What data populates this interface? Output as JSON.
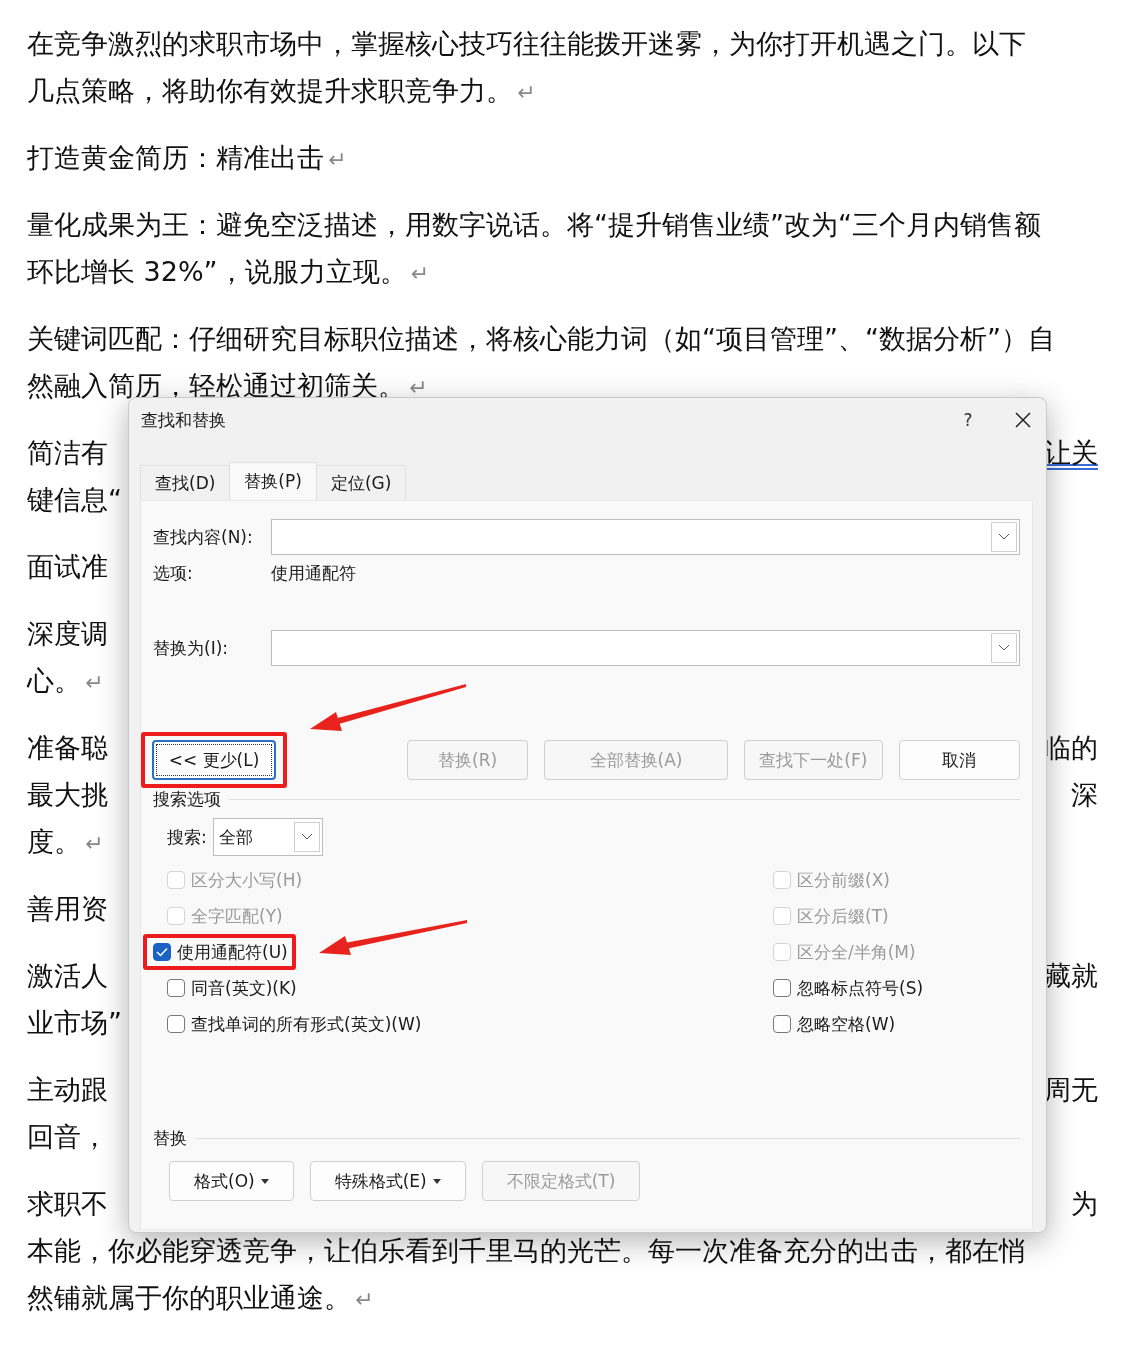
{
  "document": {
    "paragraphs": [
      {
        "lines": [
          {
            "text": "在竞争激烈的求职市场中，掌握核心技巧往往能拨开迷雾，为你打开机遇之门。以下"
          },
          {
            "text": "几点策略，将助你有效提升求职竞争力。"
          }
        ],
        "end_mark": "↵"
      },
      {
        "lines": [
          {
            "text": "打造黄金简历：精准出击"
          }
        ],
        "end_mark": "↵"
      },
      {
        "lines": [
          {
            "text": "量化成果为王：避免空泛描述，用数字说话。将“提升销售业绩”改为“三个月内销售额"
          },
          {
            "text": "环比增长 32%”，说服力立现。"
          }
        ],
        "end_mark": "↵"
      },
      {
        "lines": [
          {
            "text": "关键词匹配：仔细研究目标职位描述，将核心能力词（如“项目管理”、“数据分析”）自"
          },
          {
            "text": "然融入简历，轻松通过初筛关。"
          }
        ],
        "end_mark": "↵"
      },
      {
        "lines": [
          {
            "left": "简洁有",
            "right": "让关"
          },
          {
            "left": "键信息“"
          }
        ]
      },
      {
        "lines": [
          {
            "left": "面试准"
          }
        ]
      },
      {
        "lines": [
          {
            "left": "深度调"
          },
          {
            "text": "心。"
          }
        ],
        "end_mark": "↵"
      },
      {
        "lines": [
          {
            "left": "准备聪",
            "right": "临的"
          },
          {
            "left": "最大挑",
            "right": "深"
          },
          {
            "text": "度。"
          }
        ],
        "end_mark": "↵"
      },
      {
        "lines": [
          {
            "left": "善用资"
          }
        ]
      },
      {
        "lines": [
          {
            "left": "激活人",
            "right": "藏就"
          },
          {
            "left": "业市场”"
          }
        ]
      },
      {
        "lines": [
          {
            "left": "主动跟",
            "right": "周无"
          },
          {
            "left": "回音，"
          }
        ]
      },
      {
        "lines": [
          {
            "left": "求职不",
            "right": "为"
          },
          {
            "text": "本能，你必能穿透竞争，让伯乐看到千里马的光芒。每一次准备充分的出击，都在悄"
          },
          {
            "text": "然铺就属于你的职业通途。"
          }
        ],
        "end_mark": "↵"
      }
    ]
  },
  "dialog": {
    "title": "查找和替换",
    "help": "?",
    "tabs": [
      {
        "label": "查找(D)",
        "selected": false
      },
      {
        "label": "替换(P)",
        "selected": true
      },
      {
        "label": "定位(G)",
        "selected": false
      }
    ],
    "find": {
      "label": "查找内容(N):"
    },
    "options": {
      "label": "选项:",
      "value": "使用通配符"
    },
    "replace": {
      "label": "替换为(I):"
    },
    "buttons": [
      {
        "label": "<< 更少(L)",
        "disabled": false,
        "focused": true,
        "highlighted": true
      },
      {
        "label": "替换(R)",
        "disabled": true,
        "focused": false,
        "highlighted": false
      },
      {
        "label": "全部替换(A)",
        "disabled": true,
        "focused": false,
        "highlighted": false
      },
      {
        "label": "查找下一处(F)",
        "disabled": true,
        "focused": false,
        "highlighted": false
      },
      {
        "label": "取消",
        "disabled": false,
        "focused": false,
        "highlighted": false
      }
    ],
    "search_options": {
      "title": "搜索选项",
      "search_label": "搜索:",
      "search_value": "全部",
      "left": [
        {
          "label": "区分大小写(H)",
          "checked": false,
          "disabled": true,
          "highlighted": false
        },
        {
          "label": "全字匹配(Y)",
          "checked": false,
          "disabled": true,
          "highlighted": false
        },
        {
          "label": "使用通配符(U)",
          "checked": true,
          "disabled": false,
          "highlighted": true
        },
        {
          "label": "同音(英文)(K)",
          "checked": false,
          "disabled": false,
          "highlighted": false
        },
        {
          "label": "查找单词的所有形式(英文)(W)",
          "checked": false,
          "disabled": false,
          "highlighted": false
        }
      ],
      "right": [
        {
          "label": "区分前缀(X)",
          "checked": false,
          "disabled": true,
          "highlighted": false
        },
        {
          "label": "区分后缀(T)",
          "checked": false,
          "disabled": true,
          "highlighted": false
        },
        {
          "label": "区分全/半角(M)",
          "checked": false,
          "disabled": true,
          "highlighted": false
        },
        {
          "label": "忽略标点符号(S)",
          "checked": false,
          "disabled": false,
          "highlighted": false
        },
        {
          "label": "忽略空格(W)",
          "checked": false,
          "disabled": false,
          "highlighted": false
        }
      ]
    },
    "replace_section": {
      "title": "替换",
      "buttons": [
        {
          "label": "格式(O)",
          "dropdown": true,
          "disabled": false
        },
        {
          "label": "特殊格式(E)",
          "dropdown": true,
          "disabled": false
        },
        {
          "label": "不限定格式(T)",
          "dropdown": false,
          "disabled": true
        }
      ]
    }
  }
}
